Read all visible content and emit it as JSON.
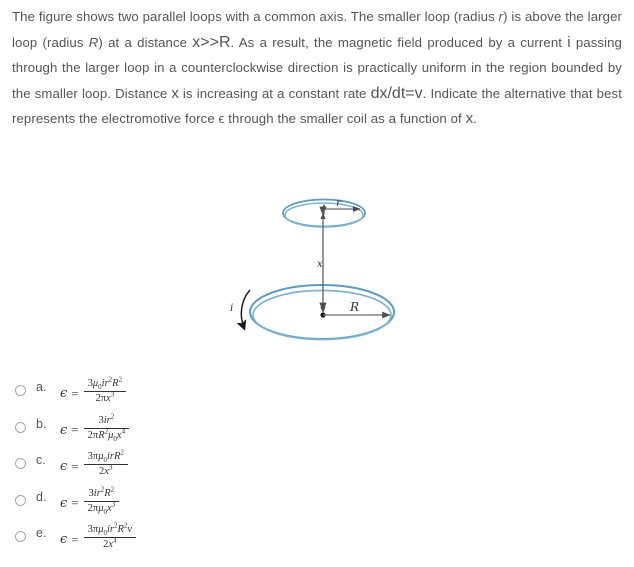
{
  "question": {
    "segments": [
      {
        "text": "The figure shows two parallel loops with a common axis. The smaller loop (radius ",
        "style": "normal"
      },
      {
        "text": "r",
        "style": "italic"
      },
      {
        "text": ") is above the larger loop (radius ",
        "style": "normal"
      },
      {
        "text": "R",
        "style": "italic"
      },
      {
        "text": ") at a distance ",
        "style": "normal"
      },
      {
        "text": "x>>R",
        "style": "big"
      },
      {
        "text": ". As a result, the magnetic field produced by a current ",
        "style": "normal"
      },
      {
        "text": "i",
        "style": "mid"
      },
      {
        "text": " passing through the larger loop in a counterclockwise direction is practically uniform in the region bounded by the smaller loop. Distance ",
        "style": "normal"
      },
      {
        "text": "x",
        "style": "mid"
      },
      {
        "text": " is increasing at a constant rate ",
        "style": "normal"
      },
      {
        "text": "dx/dt=v",
        "style": "big"
      },
      {
        "text": ". Indicate the alternative that best represents the electromotive force ",
        "style": "normal"
      },
      {
        "text": "ϵ",
        "style": "normal"
      },
      {
        "text": " through the smaller coil as a function of ",
        "style": "normal"
      },
      {
        "text": "x",
        "style": "mid"
      },
      {
        "text": ".",
        "style": "normal"
      }
    ],
    "full_text": "The figure shows two parallel loops with a common axis. The smaller loop (radius r) is above the larger loop (radius R) at a distance x>>R. As a result, the magnetic field produced by a current i passing through the larger loop in a counterclockwise direction is practically uniform in the region bounded by the smaller loop. Distance x is increasing at a constant rate dx/dt=v. Indicate the alternative that best represents the electromotive force ϵ through the smaller coil as a function of x."
  },
  "figure": {
    "name": "two-parallel-loops-diagram",
    "loop_color": "#5b9bc4",
    "line_color": "#595959",
    "labels": {
      "small_radius": "r",
      "large_radius": "R",
      "axis_distance": "x",
      "current": "i"
    }
  },
  "options": [
    {
      "letter": "a.",
      "epsilon": "ϵ",
      "equals": "=",
      "numerator_html": "3<i>μ</i><sub>0</sub><i>ir</i><sup>2</sup><i>R</i><sup>2</sup>",
      "denominator_html": "2π<i>x</i><sup>3</sup>",
      "selected": false
    },
    {
      "letter": "b.",
      "epsilon": "ϵ",
      "equals": "=",
      "numerator_html": "3<i>ir</i><sup>2</sup>",
      "denominator_html": "2π<i>R</i><sup>2</sup><i>μ</i><sub>0</sub><i>x</i><sup>4</sup>",
      "selected": false
    },
    {
      "letter": "c.",
      "epsilon": "ϵ",
      "equals": "=",
      "numerator_html": "3π<i>μ</i><sub>0</sub><i>irR</i><sup>2</sup>",
      "denominator_html": "2<i>x</i><sup>3</sup>",
      "selected": false
    },
    {
      "letter": "d.",
      "epsilon": "ϵ",
      "equals": "=",
      "numerator_html": "3<i>ir</i><sup>2</sup><i>R</i><sup>2</sup>",
      "denominator_html": "2π<i>μ</i><sub>0</sub><i>x</i><sup>3</sup>",
      "selected": false
    },
    {
      "letter": "e.",
      "epsilon": "ϵ",
      "equals": "=",
      "numerator_html": "3π<i>μ</i><sub>0</sub><i>ir</i><sup>2</sup><i>R</i><sup>2</sup><i>v</i>",
      "denominator_html": "2<i>x</i><sup>4</sup>",
      "selected": false
    }
  ]
}
